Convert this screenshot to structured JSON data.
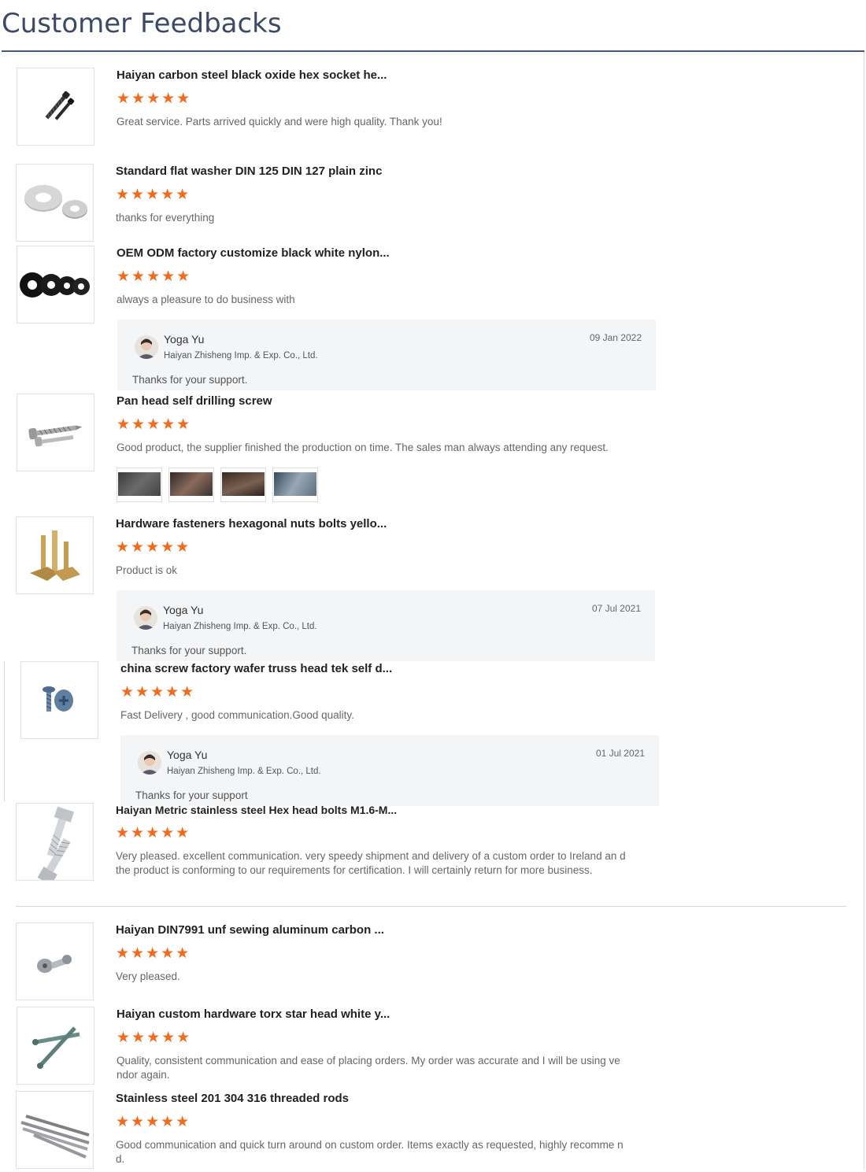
{
  "header": {
    "title": "Customer Feedbacks"
  },
  "colors": {
    "accent": "#3c4a66",
    "star": "#f26b1d",
    "reply_bg": "#f4f5f7"
  },
  "reviews": [
    {
      "product": "Haiyan carbon steel black oxide hex socket he...",
      "rating": 5,
      "stars": "★★★★★",
      "comment": "Great service. Parts arrived quickly and were high quality. Thank you!",
      "icon": "black-socket-screw-icon"
    },
    {
      "product": "Standard flat washer DIN 125 DIN 127 plain zinc",
      "rating": 5,
      "stars": "★★★★★",
      "comment": "thanks for everything",
      "icon": "flat-washer-icon"
    },
    {
      "product": "OEM ODM factory customize black white nylon...",
      "rating": 5,
      "stars": "★★★★★",
      "comment": "always a pleasure to do business with",
      "icon": "nylon-washer-icon"
    },
    {
      "product": "Pan head self drilling screw",
      "rating": 5,
      "stars": "★★★★★",
      "comment": "Good product, the supplier finished the production on time. The sales man always attending any request.",
      "icon": "self-drilling-screw-icon"
    },
    {
      "product": "Hardware fasteners hexagonal nuts bolts yello...",
      "rating": 5,
      "stars": "★★★★★",
      "comment": "Product is ok",
      "icon": "brass-bolts-icon"
    },
    {
      "product": "china screw factory wafer truss head tek self d...",
      "rating": 5,
      "stars": "★★★★★",
      "comment": "Fast Delivery , good communication.Good quality.",
      "icon": "truss-head-screw-icon"
    },
    {
      "product": "Haiyan Metric stainless steel Hex head bolts M1.6-M...",
      "rating": 5,
      "stars": "★★★★★",
      "comment": "Very pleased. excellent communication. very speedy shipment and delivery of a custom order to Ireland an d the product is conforming to our requirements for certification. I will certainly return for more business.",
      "icon": "hex-head-bolt-icon"
    },
    {
      "product": "Haiyan DIN7991 unf sewing aluminum carbon ...",
      "rating": 5,
      "stars": "★★★★★",
      "comment": "Very pleased.",
      "icon": "sewing-screw-icon"
    },
    {
      "product": "Haiyan custom hardware torx star head white y...",
      "rating": 5,
      "stars": "★★★★★",
      "comment": "Quality, consistent communication and ease of placing orders. My order was accurate and I will be using ve ndor again.",
      "icon": "torx-screw-icon"
    },
    {
      "product": "Stainless steel 201 304 316 threaded rods",
      "rating": 5,
      "stars": "★★★★★",
      "comment": "Good communication and quick turn around on custom order. Items exactly as requested, highly recomme nd.",
      "icon": "threaded-rod-icon"
    }
  ],
  "replies": [
    {
      "name": "Yoga Yu",
      "company": "Haiyan Zhisheng Imp. & Exp. Co., Ltd.",
      "date": "09 Jan 2022",
      "text": "Thanks for your support."
    },
    {
      "name": "Yoga Yu",
      "company": "Haiyan Zhisheng Imp. & Exp. Co., Ltd.",
      "date": "07 Jul 2021",
      "text": "Thanks for your support."
    },
    {
      "name": "Yoga Yu",
      "company": "Haiyan Zhisheng Imp. & Exp. Co., Ltd.",
      "date": "01 Jul 2021",
      "text": "Thanks for your support"
    }
  ],
  "review_photos": [
    "photo-1",
    "photo-2",
    "photo-3",
    "photo-4"
  ]
}
